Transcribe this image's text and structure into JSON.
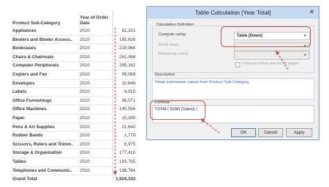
{
  "table": {
    "header_subcategory": "Product Sub-Category",
    "header_year": "Year of Order Date",
    "rows": [
      {
        "name": "Appliances",
        "year": "2010",
        "value": "82,201"
      },
      {
        "name": "Binders and Binder Access..",
        "year": "2010",
        "value": "185,828"
      },
      {
        "name": "Bookcases",
        "year": "2010",
        "value": "219,964"
      },
      {
        "name": "Chairs & Chairmats",
        "year": "2010",
        "value": "261,068"
      },
      {
        "name": "Computer Peripherals",
        "year": "2010",
        "value": "295,162"
      },
      {
        "name": "Copiers and Fax",
        "year": "2010",
        "value": "99,069"
      },
      {
        "name": "Envelopes",
        "year": "2010",
        "value": "10,649"
      },
      {
        "name": "Labels",
        "year": "2010",
        "value": "4,915"
      },
      {
        "name": "Office Furnishings",
        "year": "2010",
        "value": "98,071"
      },
      {
        "name": "Office Machines",
        "year": "2010",
        "value": "145,556"
      },
      {
        "name": "Paper",
        "year": "2010",
        "value": "15,285"
      },
      {
        "name": "Pens & Art Supplies",
        "year": "2010",
        "value": "21,642"
      },
      {
        "name": "Rubber Bands",
        "year": "2010",
        "value": "1,779"
      },
      {
        "name": "Scissors, Rulers and Trimm..",
        "year": "2010",
        "value": "6,975"
      },
      {
        "name": "Storage & Organization",
        "year": "2010",
        "value": "177,418"
      },
      {
        "name": "Tables",
        "year": "2010",
        "value": "193,765"
      },
      {
        "name": "Telephones and Communic..",
        "year": "2010",
        "value": "198,764"
      }
    ],
    "grand_total_label": "Grand Total",
    "grand_total_value": "1,924,333"
  },
  "dialog": {
    "title": "Table Calculation [Year Total]",
    "close_glyph": "✕",
    "calc_definition_label": "Calculation Definition",
    "compute_using_label": "Compute using:",
    "compute_using_value": "Table (Down)",
    "at_level_label": "At the level:",
    "restarting_every_label": "Restarting every:",
    "compute_totals_label": "Compute totals across all pages",
    "description_label": "Description",
    "description_text": "Totals summarize values from Product Sub-Category.",
    "formula_label": "Formula",
    "formula_text": "TOTAL( SUM( [Sales]) )",
    "ok_label": "OK",
    "cancel_label": "Cancel",
    "apply_label": "Apply"
  },
  "colors": {
    "annotation": "#c0504d",
    "title_bar": "#c5d9f1",
    "description_text": "#2b64c2"
  }
}
